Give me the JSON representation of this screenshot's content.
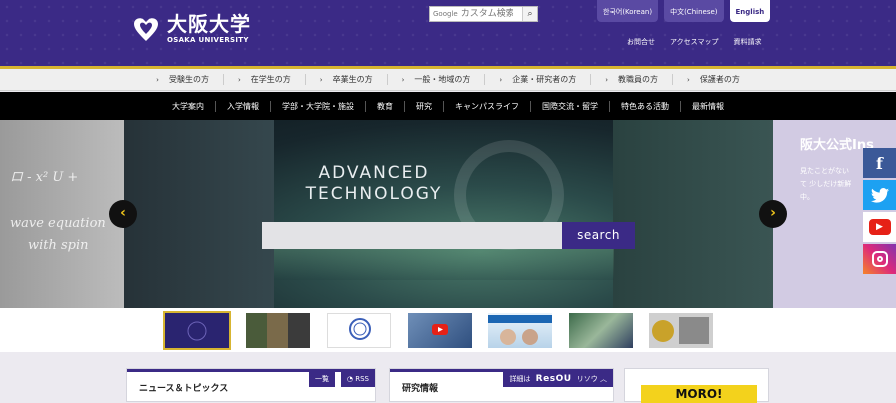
{
  "header": {
    "logo_ja": "大阪大学",
    "logo_en": "OSAKA UNIVERSITY",
    "google_label": "Google",
    "search_placeholder": "カスタム検索",
    "search_button_icon": "magnifier-icon",
    "languages": [
      {
        "label": "한국어(Korean)"
      },
      {
        "label": "中文(Chinese)"
      },
      {
        "label": "English"
      }
    ],
    "util_links": [
      "お問合せ",
      "アクセスマップ",
      "資料請求"
    ],
    "brand_color": "#3b2a86",
    "accent_color": "#d7b531"
  },
  "audience_nav": [
    "受験生の方",
    "在学生の方",
    "卒業生の方",
    "一般・地域の方",
    "企業・研究者の方",
    "教職員の方",
    "保護者の方"
  ],
  "main_nav": [
    "大学案内",
    "入学情報",
    "学部・大学院・施設",
    "教育",
    "研究",
    "キャンパスライフ",
    "国際交流・留学",
    "特色ある活動",
    "最新情報"
  ],
  "hero": {
    "headline_line1": "ADVANCED",
    "headline_line2": "TECHNOLOGY",
    "search_button": "search",
    "left_text_1": "ロ - x² U +",
    "left_text_2": "wave equation",
    "left_text_3": "with spin",
    "right_title": "阪大公式Ins",
    "right_body": "見たことがない\nて 少しだけ新鮮\n中。",
    "prev_icon": "arrow-left-icon",
    "next_icon": "arrow-right-icon"
  },
  "social": [
    {
      "name": "facebook-icon",
      "glyph": "f"
    },
    {
      "name": "twitter-icon",
      "glyph": "🐦"
    },
    {
      "name": "youtube-icon",
      "glyph": "▶"
    },
    {
      "name": "instagram-icon",
      "glyph": ""
    }
  ],
  "panels": {
    "news_title": "ニュース＆トピックス",
    "news_list": "一覧",
    "news_rss": "RSS",
    "research_title": "研究情報",
    "research_detail": "詳細は",
    "research_logo": "ResOU",
    "research_sub": "リソウ",
    "moro_text": "MORO!"
  }
}
